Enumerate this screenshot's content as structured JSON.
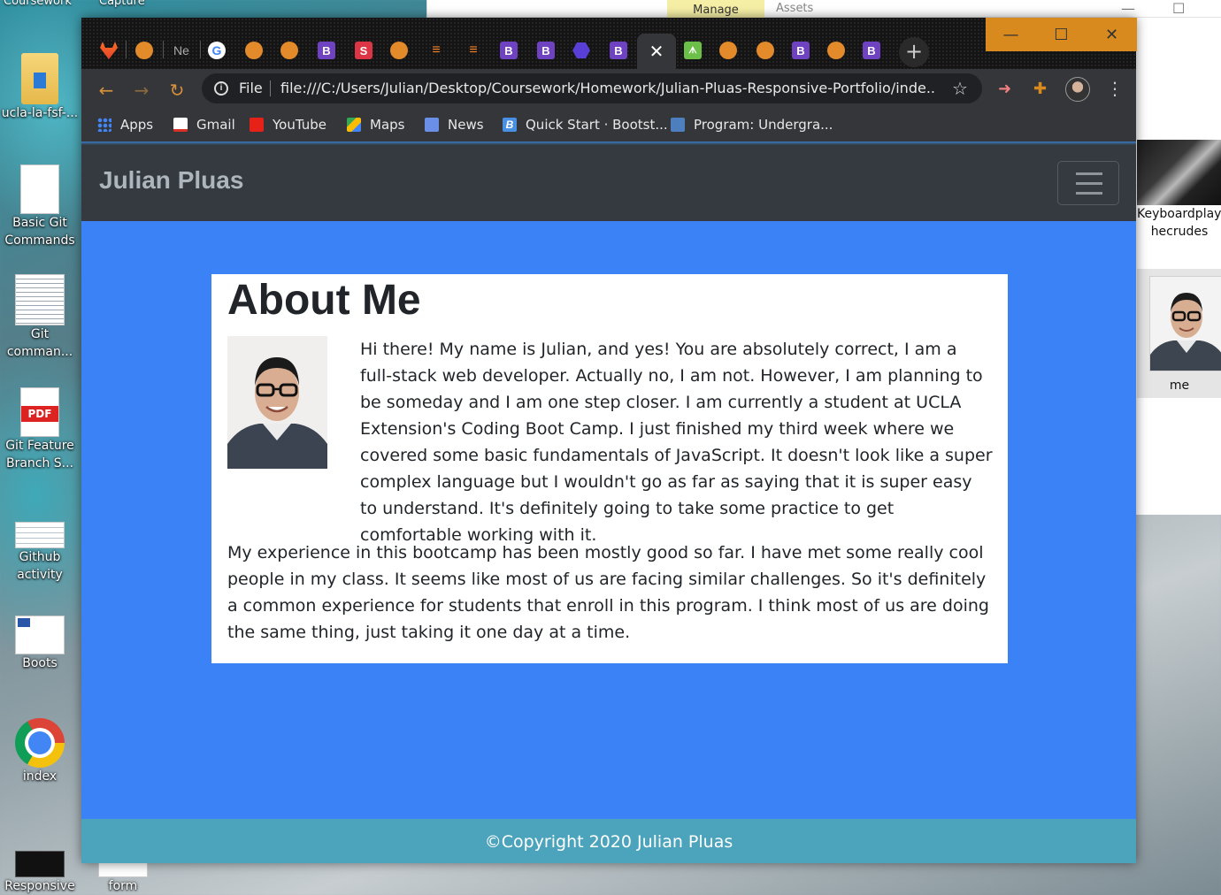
{
  "desktop": {
    "top_labels": [
      "Coursework",
      "Capture"
    ],
    "icons": [
      {
        "label": "ucla-la-fsf-...",
        "thumb": "folder-icon"
      },
      {
        "label": "Basic Git Commands",
        "thumb": "text-document-icon"
      },
      {
        "label": "Git comman...",
        "thumb": "document-image-icon"
      },
      {
        "label": "Git Feature Branch S...",
        "thumb": "pdf-icon",
        "badge": "PDF"
      },
      {
        "label": "Github activity",
        "thumb": "image-thumbnail-icon"
      },
      {
        "label": "Boots",
        "thumb": "image-thumbnail-icon"
      },
      {
        "label": "index",
        "thumb": "chrome-icon"
      },
      {
        "label": "Responsive",
        "thumb": "image-thumbnail-icon"
      },
      {
        "label": "form",
        "thumb": "image-thumbnail-icon"
      }
    ]
  },
  "explorer": {
    "ribbon_tabs": {
      "manage": "Manage",
      "assets": "Assets"
    },
    "files": [
      {
        "label": "Keyboardplayer hecrudes"
      },
      {
        "label": "me"
      }
    ]
  },
  "browser": {
    "tabs": [
      {
        "icon": "gitlab-icon"
      },
      {
        "icon": "globe-icon"
      },
      {
        "icon": "new-tab-icon",
        "text": "Ne"
      },
      {
        "icon": "google-icon",
        "text": "G"
      },
      {
        "icon": "globe-icon"
      },
      {
        "icon": "globe-icon"
      },
      {
        "icon": "bootstrap-icon",
        "text": "B"
      },
      {
        "icon": "s-icon",
        "text": "S"
      },
      {
        "icon": "globe-icon"
      },
      {
        "icon": "stackoverflow-icon",
        "text": "≡"
      },
      {
        "icon": "stackoverflow-icon",
        "text": "≡"
      },
      {
        "icon": "bootstrap-icon",
        "text": "B"
      },
      {
        "icon": "bootstrap-icon",
        "text": "B"
      },
      {
        "icon": "hexagon-icon"
      },
      {
        "icon": "bootstrap-icon",
        "text": "B"
      },
      {
        "icon": "close-icon",
        "text": "✕",
        "active": true
      },
      {
        "icon": "green-app-icon",
        "text": "ᗑ"
      },
      {
        "icon": "globe-icon"
      },
      {
        "icon": "globe-icon"
      },
      {
        "icon": "bootstrap-icon",
        "text": "B"
      },
      {
        "icon": "globe-icon"
      },
      {
        "icon": "bootstrap-icon",
        "text": "B"
      }
    ],
    "new_tab": "+",
    "window_controls": {
      "minimize": "—",
      "maximize": "☐",
      "close": "✕"
    },
    "address": {
      "scheme_label": "File",
      "url": "file:///C:/Users/Julian/Desktop/Coursework/Homework/Julian-Pluas-Responsive-Portfolio/inde..."
    },
    "bookmarks": [
      {
        "label": "Apps",
        "icon": "apps-icon"
      },
      {
        "label": "Gmail",
        "icon": "gmail-icon"
      },
      {
        "label": "YouTube",
        "icon": "youtube-icon"
      },
      {
        "label": "Maps",
        "icon": "maps-icon"
      },
      {
        "label": "News",
        "icon": "news-icon"
      },
      {
        "label": "Quick Start · Bootst...",
        "icon": "bootstrap-icon"
      },
      {
        "label": "Program: Undergra...",
        "icon": "program-icon"
      }
    ]
  },
  "site": {
    "brand": "Julian Pluas",
    "about": {
      "title": "About Me",
      "paragraph1": "Hi there! My name is Julian, and yes! You are absolutely correct, I am a full-stack web developer. Actually no, I am not. However, I am planning to be someday and I am one step closer. I am currently a student at UCLA Extension's Coding Boot Camp. I just finished my third week where we covered some basic fundamentals of JavaScript. It doesn't look like a super complex language but I wouldn't go as far as saying that it is super easy to understand. It's definitely going to take some practice to get comfortable working with it.",
      "paragraph2": "My experience in this bootcamp has been mostly good so far. I have met some really cool people in my class. It seems like most of us are facing similar challenges. So it's definitely a common experience for students that enroll in this program. I think most of us are doing the same thing, just taking it one day at a time."
    },
    "footer": "©Copyright 2020 Julian Pluas"
  },
  "colors": {
    "page_bg": "#3b82f6",
    "navbar_bg": "#343a40",
    "footer_bg": "#4ba3bc",
    "window_controls": "#d88a1e"
  }
}
